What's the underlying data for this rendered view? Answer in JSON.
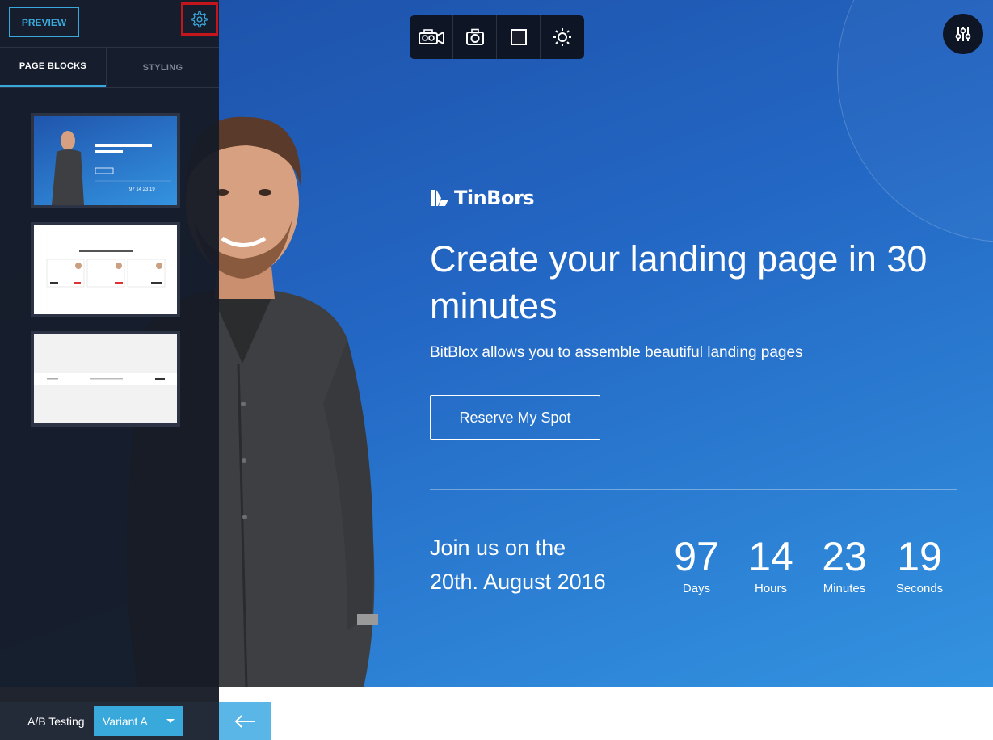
{
  "sidebar": {
    "preview_label": "PREVIEW",
    "tabs": [
      {
        "label": "PAGE BLOCKS",
        "active": true
      },
      {
        "label": "STYLING",
        "active": false
      }
    ],
    "thumbnails": [
      {
        "kind": "hero-block",
        "title": "Create your landing page in 30 minutes",
        "counter": [
          "97",
          "14",
          "23",
          "19"
        ]
      },
      {
        "kind": "testimonials-block",
        "title": "Hear what others think of Upskill"
      },
      {
        "kind": "footer-block"
      }
    ],
    "ab_testing_label": "A/B Testing",
    "variant_value": "Variant A"
  },
  "toolbar": {
    "items": [
      "video-camera-icon",
      "camera-icon",
      "square-icon",
      "sun-icon"
    ]
  },
  "hero": {
    "brand": "TinBors",
    "headline": "Create your landing page in 30 minutes",
    "subheadline": "BitBlox allows you to assemble beautiful landing pages",
    "cta_label": "Reserve My Spot",
    "event_line_1": "Join us on the",
    "event_line_2": "20th. August 2016",
    "countdown": [
      {
        "value": "97",
        "label": "Days"
      },
      {
        "value": "14",
        "label": "Hours"
      },
      {
        "value": "23",
        "label": "Minutes"
      },
      {
        "value": "19",
        "label": "Seconds"
      }
    ]
  },
  "colors": {
    "accent": "#39a9dc",
    "sidebar_bg": "#161b26",
    "highlight_border": "#c4151c",
    "hero_start": "#1d4fa6",
    "hero_end": "#3393e0"
  }
}
